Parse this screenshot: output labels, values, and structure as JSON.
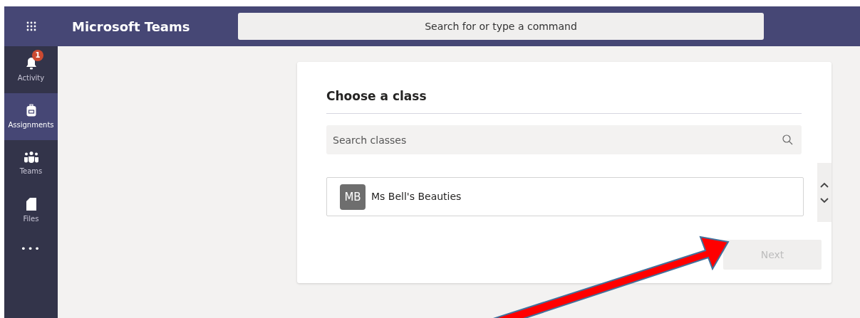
{
  "app_bar": {
    "title": "Microsoft Teams",
    "search": {
      "placeholder": "Search for or type a command"
    }
  },
  "sidebar": {
    "items": [
      {
        "kind": "bell",
        "label": "Activity",
        "badge": "1",
        "selected": false
      },
      {
        "kind": "backpack",
        "label": "Assignments",
        "selected": true
      },
      {
        "kind": "people",
        "label": "Teams",
        "selected": false
      },
      {
        "kind": "file",
        "label": "Files",
        "selected": false
      }
    ],
    "more": "•••"
  },
  "dialog": {
    "title": "Choose a class",
    "search": {
      "placeholder": "Search classes"
    },
    "classes": [
      {
        "initials": "MB",
        "name": "Ms Bell's Beauties"
      }
    ],
    "next_button": {
      "label": "Next",
      "disabled": true
    }
  }
}
